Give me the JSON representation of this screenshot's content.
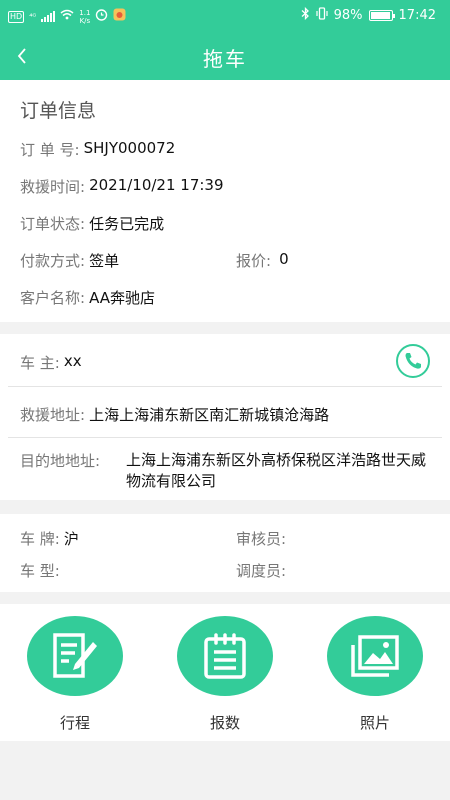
{
  "statusbar": {
    "hd": "HD",
    "signal": "⁴ᴳ",
    "speed": "1.1\nK/s",
    "battery": "98%",
    "time": "17:42"
  },
  "nav": {
    "title": "拖车"
  },
  "order": {
    "section_title": "订单信息",
    "order_no_label": "订 单 号:",
    "order_no": "SHJY000072",
    "rescue_time_label": "救援时间:",
    "rescue_time": "2021/10/21 17:39",
    "status_label": "订单状态:",
    "status": "任务已完成",
    "payment_label": "付款方式:",
    "payment": "签单",
    "quote_label": "报价:",
    "quote": "0",
    "customer_label": "客户名称:",
    "customer": "AA奔驰店"
  },
  "address": {
    "owner_label": "车 主:",
    "owner": "xx",
    "rescue_addr_label": "救援地址:",
    "rescue_addr": "上海上海浦东新区南汇新城镇沧海路",
    "dest_addr_label": "目的地地址:",
    "dest_addr": "上海上海浦东新区外高桥保税区洋浩路世天威物流有限公司"
  },
  "vehicle": {
    "plate_label": "车 牌:",
    "plate": "沪",
    "reviewer_label": "审核员:",
    "reviewer": "",
    "model_label": "车 型:",
    "model": "",
    "dispatcher_label": "调度员:",
    "dispatcher": ""
  },
  "actions": [
    {
      "label": "行程",
      "icon": "document-edit-icon"
    },
    {
      "label": "报数",
      "icon": "clipboard-list-icon"
    },
    {
      "label": "照片",
      "icon": "photo-gallery-icon"
    }
  ],
  "colors": {
    "accent": "#33cc99",
    "background": "#f2f2f2"
  }
}
